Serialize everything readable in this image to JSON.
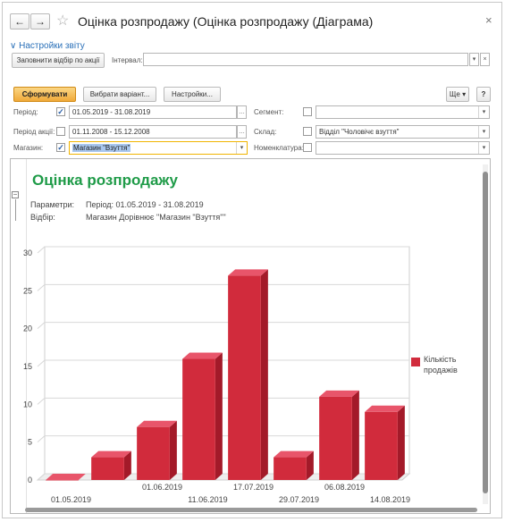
{
  "window": {
    "title": "Оцінка розпродажу (Оцінка розпродажу (Діаграма)",
    "back": "←",
    "forward": "→",
    "favorite": "☆",
    "close": "×"
  },
  "settings_link": "Настройки звіту",
  "toolbar1": {
    "fill_button": "Заповнити відбір по акції",
    "interval_label": "Інтервал:",
    "interval_value": ""
  },
  "toolbar2": {
    "run": "Сформувати",
    "choose_variant": "Вибрати варіант...",
    "settings": "Настройки...",
    "more": "Ще ▾",
    "help": "?"
  },
  "filters": {
    "period_label": "Період:",
    "period_value": "01.05.2019 - 31.08.2019",
    "period_checked": true,
    "promo_period_label": "Період акції:",
    "promo_period_value": "01.11.2008 - 15.12.2008",
    "promo_checked": false,
    "store_label": "Магазин:",
    "store_value": "Магазин \"Взуття\"",
    "store_checked": true,
    "segment_label": "Сегмент:",
    "segment_value": "",
    "segment_checked": false,
    "warehouse_label": "Склад:",
    "warehouse_value": "Відділ \"Чоловічє взуття\"",
    "warehouse_checked": false,
    "nomenclature_label": "Номенклатура:",
    "nomenclature_value": "",
    "nomenclature_checked": false
  },
  "report": {
    "title": "Оцінка розпродажу",
    "params_label": "Параметри:",
    "params_value": "Період: 01.05.2019 - 31.08.2019",
    "filter_label": "Відбір:",
    "filter_value": "Магазин Дорівнює \"Магазин \"Взуття\"\""
  },
  "chart_data": {
    "type": "bar",
    "categories": [
      "01.05.2019",
      "",
      "01.06.2019",
      "11.06.2019",
      "17.07.2019",
      "29.07.2019",
      "06.08.2019",
      "14.08.2019"
    ],
    "x_tick_labels_upper": [
      "01.06.2019",
      "17.07.2019",
      "06.08.2019"
    ],
    "x_tick_labels_lower": [
      "01.05.2019",
      "11.06.2019",
      "29.07.2019",
      "14.08.2019"
    ],
    "series": [
      {
        "name": "Кількість продажів",
        "values": [
          0,
          3,
          7,
          16,
          27,
          3,
          11,
          9
        ]
      }
    ],
    "ylim": [
      0,
      30
    ],
    "yticks": [
      0,
      5,
      10,
      15,
      20,
      25,
      30
    ],
    "grid": true,
    "legend": "right",
    "bar_color": "#d12b3c",
    "bar_top_color": "#e8556a",
    "bar_side_color": "#a31a29"
  }
}
